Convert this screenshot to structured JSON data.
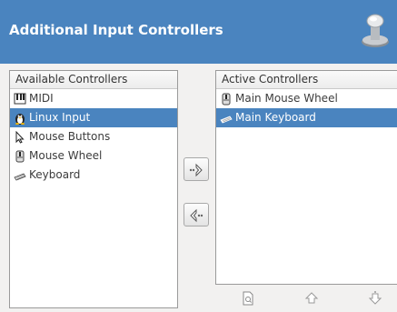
{
  "header": {
    "title": "Additional Input Controllers",
    "icon": "joystick-icon"
  },
  "available": {
    "title": "Available Controllers",
    "items": [
      {
        "label": "MIDI",
        "icon": "midi-icon",
        "selected": false
      },
      {
        "label": "Linux Input",
        "icon": "linux-input-icon",
        "selected": true
      },
      {
        "label": "Mouse Buttons",
        "icon": "mouse-pointer-icon",
        "selected": false
      },
      {
        "label": "Mouse Wheel",
        "icon": "mouse-wheel-icon",
        "selected": false
      },
      {
        "label": "Keyboard",
        "icon": "keyboard-icon",
        "selected": false
      }
    ]
  },
  "active": {
    "title": "Active Controllers",
    "items": [
      {
        "label": "Main Mouse Wheel",
        "icon": "mouse-wheel-icon",
        "selected": false
      },
      {
        "label": "Main Keyboard",
        "icon": "keyboard-icon",
        "selected": true
      }
    ]
  },
  "colors": {
    "accent": "#4a84bf",
    "background": "#f2f1f0"
  }
}
